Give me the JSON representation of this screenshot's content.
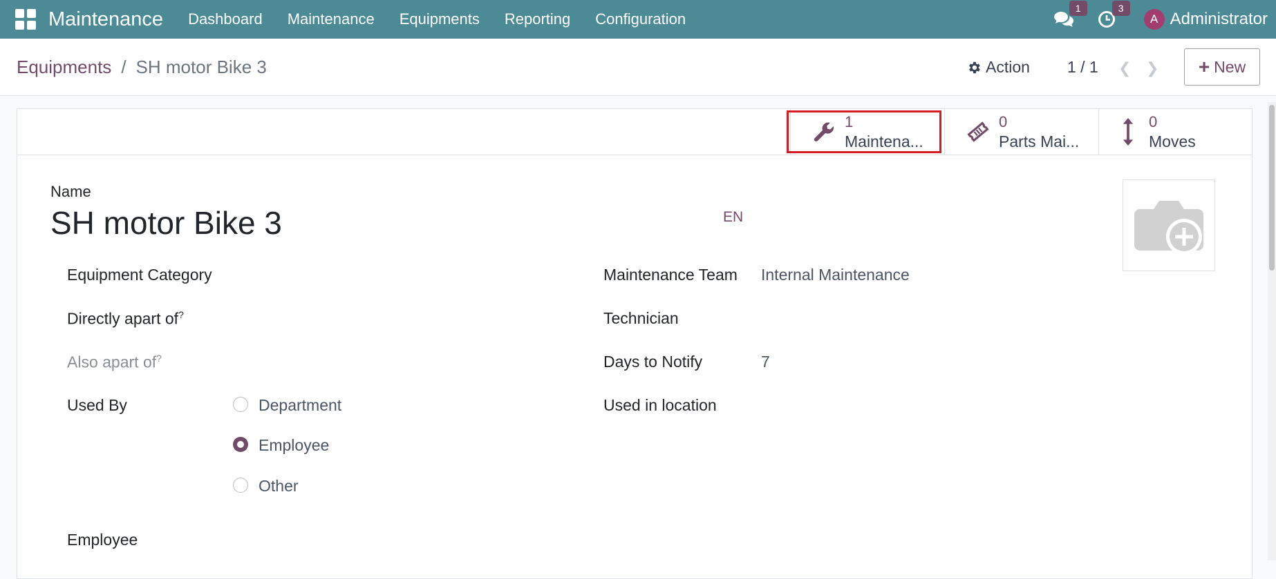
{
  "nav": {
    "brand": "Maintenance",
    "menu": [
      "Dashboard",
      "Maintenance",
      "Equipments",
      "Reporting",
      "Configuration"
    ],
    "messages_count": "1",
    "activities_count": "3",
    "avatar_letter": "A",
    "user": "Administrator"
  },
  "control_panel": {
    "breadcrumb_parent": "Equipments",
    "breadcrumb_sep": "/",
    "breadcrumb_current": "SH motor Bike 3",
    "action_label": "Action",
    "pager": "1 / 1",
    "new_label": "New"
  },
  "smart_buttons": [
    {
      "value": "1",
      "label": "Maintena..."
    },
    {
      "value": "0",
      "label": "Parts Mai..."
    },
    {
      "value": "0",
      "label": "Moves"
    }
  ],
  "form": {
    "name_label": "Name",
    "name_value": "SH motor Bike 3",
    "lang": "EN",
    "equipment_category_label": "Equipment Category",
    "directly_apart_label": "Directly apart of",
    "also_apart_label": "Also apart of",
    "help_mark": "?",
    "used_by_label": "Used By",
    "used_by_options": [
      "Department",
      "Employee",
      "Other"
    ],
    "used_by_selected": "Employee",
    "employee_label": "Employee",
    "maintenance_team_label": "Maintenance Team",
    "maintenance_team_value": "Internal Maintenance",
    "technician_label": "Technician",
    "days_to_notify_label": "Days to Notify",
    "days_to_notify_value": "7",
    "used_in_location_label": "Used in location"
  },
  "colors": {
    "navbar": "#4c8b96",
    "accent": "#714b67",
    "highlight": "#d51b24"
  }
}
